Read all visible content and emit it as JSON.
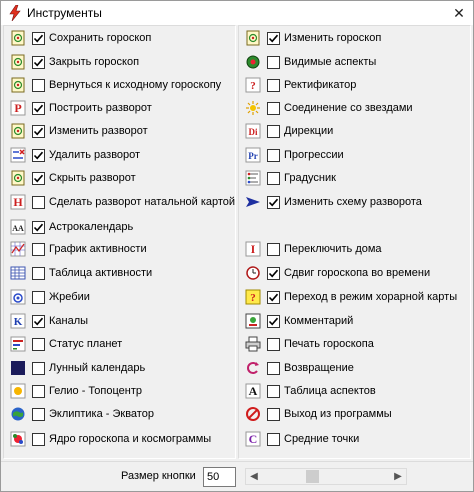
{
  "window": {
    "title": "Инструменты"
  },
  "left": [
    {
      "label": "Сохранить гороскоп",
      "checked": true,
      "icon": "save-horoscope-icon"
    },
    {
      "label": "Закрыть гороскоп",
      "checked": true,
      "icon": "close-horoscope-icon"
    },
    {
      "label": "Вернуться к исходному гороскопу",
      "checked": false,
      "icon": "return-original-icon"
    },
    {
      "label": "Построить разворот",
      "checked": true,
      "icon": "build-spread-icon"
    },
    {
      "label": "Изменить разворот",
      "checked": true,
      "icon": "edit-spread-icon"
    },
    {
      "label": "Удалить разворот",
      "checked": true,
      "icon": "delete-spread-icon"
    },
    {
      "label": "Скрыть разворот",
      "checked": true,
      "icon": "hide-spread-icon"
    },
    {
      "label": "Сделать разворот натальной картой",
      "checked": false,
      "icon": "spread-to-natal-icon"
    },
    {
      "label": "Астрокалендарь",
      "checked": true,
      "icon": "astro-calendar-icon"
    },
    {
      "label": "График активности",
      "checked": false,
      "icon": "activity-chart-icon"
    },
    {
      "label": "Таблица активности",
      "checked": false,
      "icon": "activity-table-icon"
    },
    {
      "label": "Жребии",
      "checked": false,
      "icon": "lots-icon"
    },
    {
      "label": "Каналы",
      "checked": true,
      "icon": "channels-icon"
    },
    {
      "label": "Статус планет",
      "checked": false,
      "icon": "planet-status-icon"
    },
    {
      "label": "Лунный календарь",
      "checked": false,
      "icon": "lunar-calendar-icon"
    },
    {
      "label": "Гелио - Топоцентр",
      "checked": false,
      "icon": "helio-topocenter-icon"
    },
    {
      "label": "Эклиптика - Экватор",
      "checked": false,
      "icon": "ecliptic-equator-icon"
    },
    {
      "label": "Ядро гороскопа и космограммы",
      "checked": false,
      "icon": "horoscope-core-icon"
    }
  ],
  "right": [
    {
      "label": "Изменить гороскоп",
      "checked": true,
      "icon": "edit-horoscope-icon"
    },
    {
      "label": "Видимые аспекты",
      "checked": false,
      "icon": "visible-aspects-icon"
    },
    {
      "label": "Ректификатор",
      "checked": false,
      "icon": "rectifier-icon"
    },
    {
      "label": "Соединение со звездами",
      "checked": false,
      "icon": "star-conjunction-icon"
    },
    {
      "label": "Дирекции",
      "checked": false,
      "icon": "directions-icon"
    },
    {
      "label": "Прогрессии",
      "checked": false,
      "icon": "progressions-icon"
    },
    {
      "label": "Градусник",
      "checked": false,
      "icon": "degree-meter-icon"
    },
    {
      "label": "Изменить схему разворота",
      "checked": true,
      "icon": "spread-scheme-icon"
    },
    {
      "label": "Переключить дома",
      "checked": false,
      "icon": "switch-houses-icon"
    },
    {
      "label": "Сдвиг гороскопа во времени",
      "checked": true,
      "icon": "time-shift-icon"
    },
    {
      "label": "Переход в режим хорарной карты",
      "checked": true,
      "icon": "horary-mode-icon"
    },
    {
      "label": "Комментарий",
      "checked": true,
      "icon": "comment-icon"
    },
    {
      "label": "Печать гороскопа",
      "checked": false,
      "icon": "print-horoscope-icon"
    },
    {
      "label": "Возвращение",
      "checked": false,
      "icon": "return-icon"
    },
    {
      "label": "Таблица аспектов",
      "checked": false,
      "icon": "aspects-table-icon"
    },
    {
      "label": "Выход из программы",
      "checked": false,
      "icon": "exit-program-icon"
    },
    {
      "label": "Средние точки",
      "checked": false,
      "icon": "midpoints-icon"
    }
  ],
  "bottom": {
    "size_label": "Размер кнопки",
    "size_value": "50"
  },
  "glyphs": {
    "build-spread-icon": "P",
    "spread-to-natal-icon": "H",
    "astro-calendar-icon": "AA",
    "channels-icon": "K",
    "directions-icon": "Di",
    "progressions-icon": "Pr",
    "switch-houses-icon": "I",
    "aspects-table-icon": "A",
    "midpoints-icon": "C",
    "rectifier-icon": "?",
    "horary-mode-icon": "?"
  },
  "colors": {
    "red": "#cc1f1f",
    "blue": "#1f3fb0",
    "purple": "#7a1fa8"
  }
}
